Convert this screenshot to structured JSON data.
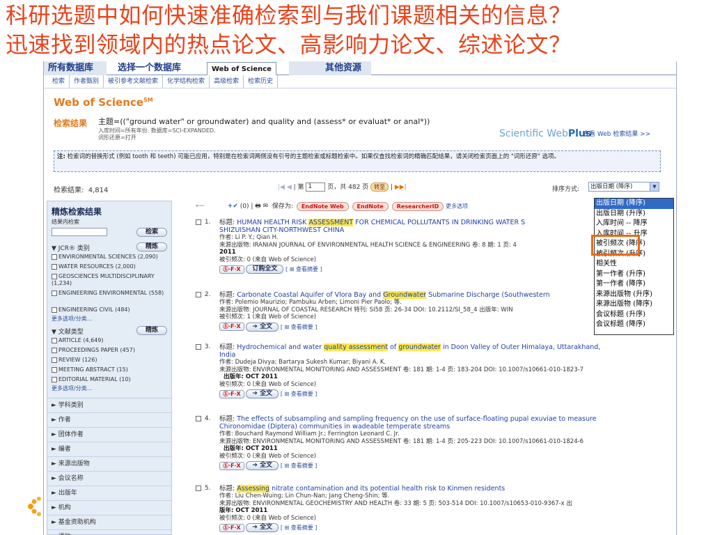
{
  "slide": {
    "title_line1": "科研选题中如何快速准确检索到与我们课题相关的信息？",
    "title_line2": "迅速找到领域内的热点论文、高影响力论文、综述论文？"
  },
  "tabs": [
    "所有数据库",
    "选择一个数据库",
    "Web of Science",
    "其他资源"
  ],
  "subnav": [
    "检索",
    "作者甄别",
    "被引参考文献检索",
    "化学结构检索",
    "高级检索",
    "检索历史"
  ],
  "brand": {
    "name": "Web of Science",
    "sup": "SM"
  },
  "search": {
    "label": "检索结果",
    "query": "主题=((\"ground water\" or groundwater) and quality and (assess* or evaluat* or anal*))",
    "line2": "入库时间=所有年份. 数据库=SCI-EXPANDED.",
    "line3": "词形还原=打开",
    "sw_prefix": "Scientific Web",
    "sw_plus": "Plus",
    "sw_link": "查看 Web 检索结果 >>"
  },
  "note": {
    "label": "注:",
    "text": "检索词的替换形式 (例如 tooth 和 teeth) 可能已应用，特别是在检索词两侧没有引号的主题检索或标题检索中。如果仅查找检索词的精确匹配结果，请关闭检索页面上的 \"词形还原\" 选项。"
  },
  "results": {
    "count_label": "检索结果:",
    "count": "4,814",
    "page_prefix": "第",
    "page_value": "1",
    "page_suffix": "页，共 482 页",
    "go": "转至",
    "sort_label": "排序方式:",
    "sort_value": "出版日期 (降序)"
  },
  "sort_options": [
    "出版日期 (降序)",
    "出版日期 (升序)",
    "入库时间 -- 降序",
    "入库时间 -- 升序",
    "被引频次 (降序)",
    "被引频次 (升序)",
    "相关性",
    "第一作者 (升序)",
    "第一作者 (降序)",
    "来源出版物 (升序)",
    "来源出版物 (降序)",
    "会议标题 (升序)",
    "会议标题 (降序)"
  ],
  "sidebar": {
    "title": "精炼检索结果",
    "within": "结果内检索",
    "search_btn": "检索",
    "refine_btn": "精炼",
    "jcr_label": "JCR® 类别",
    "jcr": [
      "ENVIRONMENTAL SCIENCES (2,090)",
      "WATER RESOURCES (2,000)",
      "GEOSCIENCES MULTIDISCIPLINARY (1,234)",
      "ENGINEERING ENVIRONMENTAL (558)",
      "ENGINEERING CIVIL (484)"
    ],
    "more": "更多选项/分类...",
    "doctype_label": "文献类型",
    "doctypes": [
      "ARTICLE (4,649)",
      "PROCEEDINGS PAPER (457)",
      "REVIEW (126)",
      "MEETING ABSTRACT (15)",
      "EDITORIAL MATERIAL (10)"
    ],
    "facets": [
      "学科类别",
      "作者",
      "团体作者",
      "编者",
      "来源出版物",
      "会议名称",
      "出版年",
      "机构",
      "基金资助机构",
      "语种"
    ]
  },
  "toolbar": {
    "count": "(0)",
    "save_as": "保存为:",
    "endnote_web": "EndNote Web",
    "endnote": "EndNote",
    "researcherid": "ResearcherID",
    "more": "更多选项"
  },
  "records": [
    {
      "num": "1.",
      "title_prefix": "标题: ",
      "title_a": "HUMAN HEALTH RISK ",
      "title_hl": "ASSESSMENT",
      "title_b": " FOR CHEMICAL POLLUTANTS IN DRINKING WATER S",
      "title_line2": "SHIZUISHAN CITY-NORTHWEST CHINA",
      "authors": "作者: Li P. Y.; Qian H.",
      "source": "来源出版物: IRANIAN JOURNAL OF ENVIRONMENTAL HEALTH SCIENCE & ENGINEERING  卷: 8  期: 1  页: 4",
      "year": "2011",
      "cited": "被引频次: 0 (来自 Web of Science)",
      "fulltext": "订购全文",
      "abstract": "[ ⊞ 查看摘要 ]"
    },
    {
      "num": "2.",
      "title_prefix": "标题: ",
      "title_a": "Carbonate Coastal Aquifer of Vlora Bay and ",
      "title_hl": "Groundwater",
      "title_b": " Submarine Discharge (Southwestern",
      "authors": "作者: Polemio Maurizio; Pambuku Arben; Limoni Pier Paolo; 等.",
      "source": "来源出版物: JOURNAL OF COASTAL RESEARCH  特刊: SI58  页: 26-34  DOI: 10.2112/SI_58_4  出版年: WIN",
      "cited": "被引频次: 1 (来自 Web of Science)",
      "fulltext": "全文",
      "abstract": "[ ⊞ 查看摘要 ]"
    },
    {
      "num": "3.",
      "title_prefix": "标题: ",
      "title_a": "Hydrochemical and water ",
      "title_hl": "quality assessment",
      "title_mid": " of ",
      "title_hl2": "groundwater",
      "title_b": " in Doon Valley of Outer Himalaya, Uttarakhand,",
      "title_line2": "India",
      "authors": "作者: Dudeja Divya; Bartarya Sukesh Kumar; Biyani A. K.",
      "source": "来源出版物: ENVIRONMENTAL MONITORING AND ASSESSMENT  卷: 181  期: 1-4  页: 183-204  DOI: 10.1007/s10661-010-1823-7",
      "year": "出版年: OCT 2011",
      "cited": "被引频次: 0 (来自 Web of Science)",
      "fulltext": "全文",
      "abstract": "[ ⊞ 查看摘要 ]"
    },
    {
      "num": "4.",
      "title_prefix": "标题: ",
      "title_a": "The effects of subsampling and sampling frequency on the use of surface-floating pupal exuviae to measure",
      "title_line2": "Chironomidae (Diptera) communities in wadeable temperate streams",
      "authors": "作者: Bouchard Raymond William Jr.; Ferrington Leonard C. Jr.",
      "source": "来源出版物: ENVIRONMENTAL MONITORING AND ASSESSMENT  卷: 181  期: 1-4  页: 205-223  DOI: 10.1007/s10661-010-1824-6",
      "year": "出版年: OCT 2011",
      "cited": "被引频次: 0 (来自 Web of Science)",
      "fulltext": "全文",
      "abstract": "[ ⊞ 查看摘要 ]"
    },
    {
      "num": "5.",
      "title_prefix": "标题: ",
      "title_hl": "Assessing",
      "title_b": " nitrate contamination and its potential health risk to Kinmen residents",
      "authors": "作者: Liu Chen-Wuing; Lin Chun-Nan; Jang Cheng-Shin; 等.",
      "source": "来源出版物: ENVIRONMENTAL GEOCHEMISTRY AND HEALTH  卷: 33  期: 5  页: 503-514  DOI: 10.1007/s10653-010-9367-x  出",
      "year": "版年: OCT 2011",
      "cited": "被引频次: 0 (来自 Web of Science)",
      "fulltext": "全文",
      "abstract": "[ ⊞ 查看摘要 ]"
    }
  ],
  "colors": {
    "title": "#e8431c",
    "brand": "#e07b1e",
    "highlight": "#ffe84a",
    "annotation": "#ea6a11",
    "link": "#1f3fa6"
  }
}
